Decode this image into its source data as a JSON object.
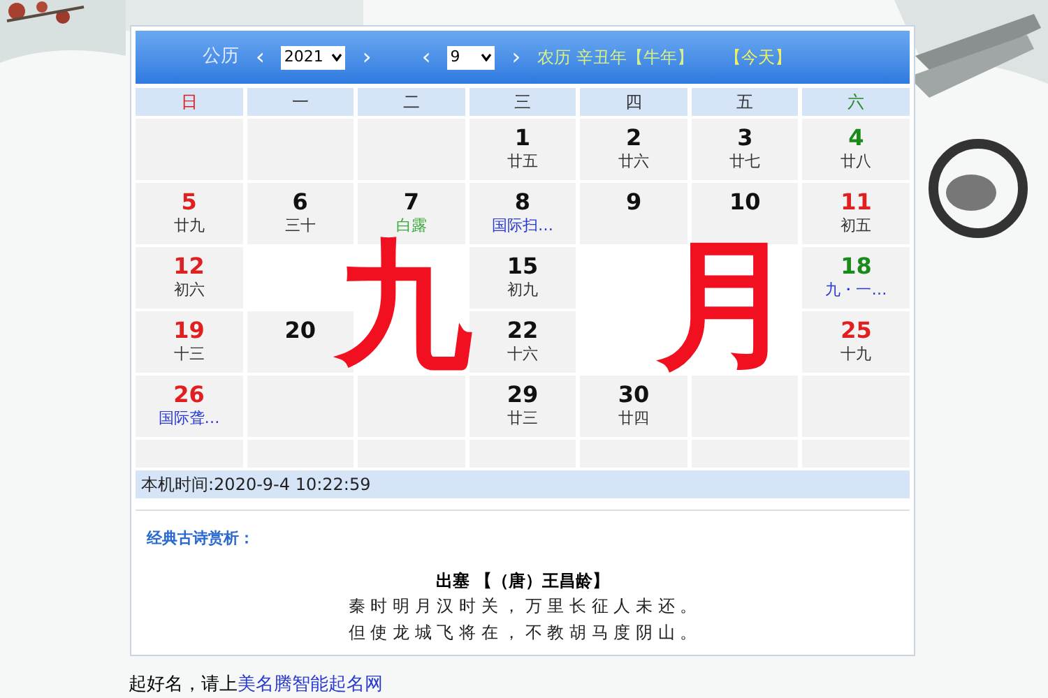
{
  "header": {
    "solar_label": "公历",
    "year_prev": "‹",
    "year": "2021",
    "year_next": "›",
    "month_prev": "‹",
    "month": "9",
    "month_next": "›",
    "lunar_year": "农历 辛丑年【牛年】",
    "today_link": "【今天】"
  },
  "weekdays": [
    {
      "label": "日",
      "color": "#e02020"
    },
    {
      "label": "一",
      "color": "#333333"
    },
    {
      "label": "二",
      "color": "#333333"
    },
    {
      "label": "三",
      "color": "#333333"
    },
    {
      "label": "四",
      "color": "#333333"
    },
    {
      "label": "五",
      "color": "#333333"
    },
    {
      "label": "六",
      "color": "#2a8a2a"
    }
  ],
  "weeks": [
    [
      {
        "kind": "blank"
      },
      {
        "kind": "blank"
      },
      {
        "kind": "blank"
      },
      {
        "kind": "date",
        "day": "1",
        "color": "#111111",
        "note": {
          "text": "廿五",
          "kind": "lunar"
        }
      },
      {
        "kind": "date",
        "day": "2",
        "color": "#111111",
        "note": {
          "text": "廿六",
          "kind": "lunar"
        }
      },
      {
        "kind": "date",
        "day": "3",
        "color": "#111111",
        "note": {
          "text": "廿七",
          "kind": "lunar"
        }
      },
      {
        "kind": "date",
        "day": "4",
        "color": "#1a8a1a",
        "note": {
          "text": "廿八",
          "kind": "lunar"
        }
      }
    ],
    [
      {
        "kind": "date",
        "day": "5",
        "color": "#e02020",
        "note": {
          "text": "廿九",
          "kind": "lunar"
        }
      },
      {
        "kind": "date",
        "day": "6",
        "color": "#111111",
        "note": {
          "text": "三十",
          "kind": "lunar"
        }
      },
      {
        "kind": "date",
        "day": "7",
        "color": "#111111",
        "note": {
          "text": "白露",
          "kind": "term"
        }
      },
      {
        "kind": "date",
        "day": "8",
        "color": "#111111",
        "note": {
          "text": "国际扫…",
          "kind": "festival"
        }
      },
      {
        "kind": "date",
        "day": "9",
        "color": "#111111"
      },
      {
        "kind": "date",
        "day": "10",
        "color": "#111111"
      },
      {
        "kind": "date",
        "day": "11",
        "color": "#e02020",
        "note": {
          "text": "初五",
          "kind": "lunar"
        }
      }
    ],
    [
      {
        "kind": "date",
        "day": "12",
        "color": "#e02020",
        "note": {
          "text": "初六",
          "kind": "lunar"
        }
      },
      {
        "kind": "covered"
      },
      {
        "kind": "covered"
      },
      {
        "kind": "date",
        "day": "15",
        "color": "#111111",
        "note": {
          "text": "初九",
          "kind": "lunar"
        }
      },
      {
        "kind": "covered"
      },
      {
        "kind": "covered"
      },
      {
        "kind": "date",
        "day": "18",
        "color": "#1a8a1a",
        "note": {
          "text": "九・一…",
          "kind": "festival"
        }
      }
    ],
    [
      {
        "kind": "date",
        "day": "19",
        "color": "#e02020",
        "note": {
          "text": "十三",
          "kind": "lunar"
        }
      },
      {
        "kind": "date",
        "day": "20",
        "color": "#111111"
      },
      {
        "kind": "covered"
      },
      {
        "kind": "date",
        "day": "22",
        "color": "#111111",
        "note": {
          "text": "十六",
          "kind": "lunar"
        }
      },
      {
        "kind": "covered"
      },
      {
        "kind": "covered"
      },
      {
        "kind": "date",
        "day": "25",
        "color": "#e02020",
        "note": {
          "text": "十九",
          "kind": "lunar"
        }
      }
    ],
    [
      {
        "kind": "date",
        "day": "26",
        "color": "#e02020",
        "note": {
          "text": "国际聋…",
          "kind": "festival"
        }
      },
      {
        "kind": "blank"
      },
      {
        "kind": "blank"
      },
      {
        "kind": "date",
        "day": "29",
        "color": "#111111",
        "note": {
          "text": "廿三",
          "kind": "lunar"
        }
      },
      {
        "kind": "date",
        "day": "30",
        "color": "#111111",
        "note": {
          "text": "廿四",
          "kind": "lunar"
        }
      },
      {
        "kind": "blank"
      },
      {
        "kind": "blank"
      }
    ],
    [
      {
        "kind": "blank"
      },
      {
        "kind": "blank"
      },
      {
        "kind": "blank"
      },
      {
        "kind": "blank"
      },
      {
        "kind": "blank"
      },
      {
        "kind": "blank"
      },
      {
        "kind": "blank"
      }
    ]
  ],
  "local_time": "本机时间:2020-9-4 10:22:59",
  "poem": {
    "section_title": "经典古诗赏析：",
    "title": "出塞 【（唐）王昌龄】",
    "lines": [
      "秦 时 明 月 汉 时 关 ， 万 里 长 征 人 未 还 。",
      "但 使 龙 城 飞 将 在 ， 不 教 胡 马 度 阴 山 。"
    ]
  },
  "footer": {
    "text": "起好名，请上",
    "link": "美名腾智能起名网"
  },
  "overlay": [
    "九",
    "月"
  ]
}
